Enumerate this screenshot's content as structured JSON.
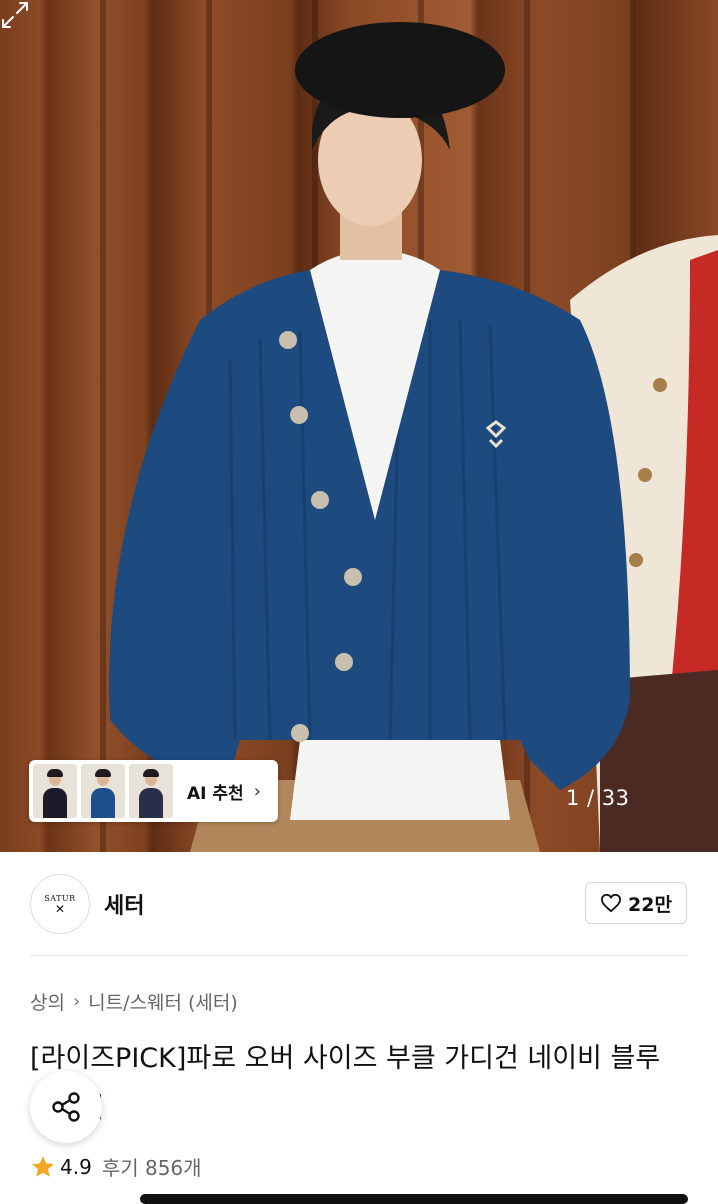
{
  "hero": {
    "image_alt": "model wearing navy ribbed cardigan",
    "recommendation": {
      "label": "AI 추천",
      "chevron": "›"
    },
    "page_counter": "1 / 33",
    "expand_icon": "expand-arrows-icon"
  },
  "brand": {
    "logo_text": "SATUR",
    "name": "세터",
    "like_count": "22만",
    "like_icon": "heart-outline-icon"
  },
  "breadcrumb": {
    "items": [
      "상의",
      "니트/스웨터 (세터)"
    ],
    "separator": "›"
  },
  "product": {
    "title": "[라이즈PICK]파로 오버 사이즈 부클 가디건 네이비 블루 네이비"
  },
  "share": {
    "icon": "share-icon"
  },
  "rating": {
    "score": "4.9",
    "reviews": "후기 856개",
    "star_color": "#f5a623"
  },
  "colors": {
    "cardigan": "#1d4a7f",
    "wood": "#8c4a26"
  }
}
